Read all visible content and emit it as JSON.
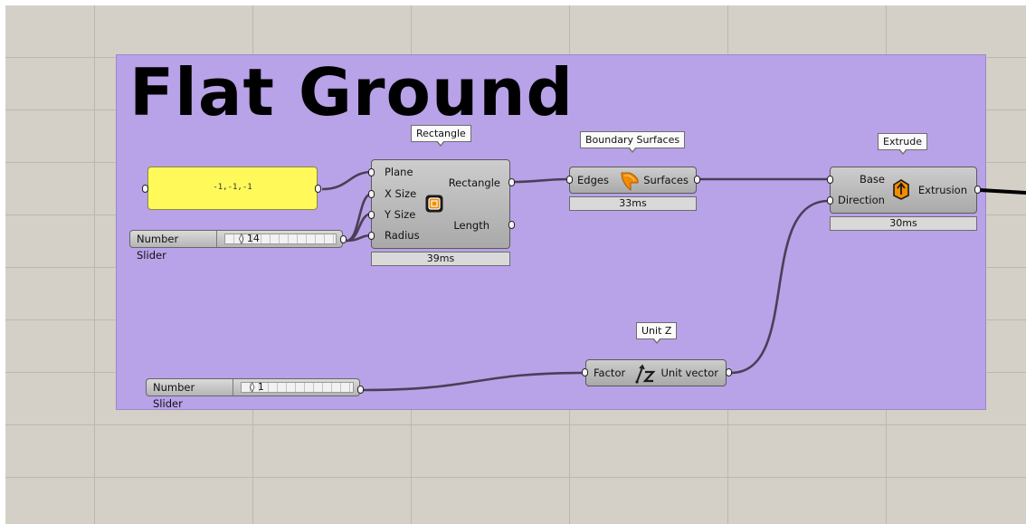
{
  "group": {
    "title": "Flat Ground",
    "color": "#b8a2e8"
  },
  "panel": {
    "text": "-1,-1,-1",
    "color": "#fff95a"
  },
  "sliders": [
    {
      "name": "Number Slider",
      "value": "◊ 14"
    },
    {
      "name": "Number Slider",
      "value": "◊ 1"
    }
  ],
  "rectangle": {
    "tag": "Rectangle",
    "inputs": [
      "Plane",
      "X Size",
      "Y Size",
      "Radius"
    ],
    "outputs": [
      "Rectangle",
      "Length"
    ],
    "icon": "rectangle-icon",
    "timing": "39ms"
  },
  "boundary": {
    "tag": "Boundary Surfaces",
    "input": "Edges",
    "output": "Surfaces",
    "icon": "boundary-surfaces-icon",
    "timing": "33ms"
  },
  "extrude": {
    "tag": "Extrude",
    "inputs": [
      "Base",
      "Direction"
    ],
    "output": "Extrusion",
    "icon": "extrude-icon",
    "timing": "30ms"
  },
  "unitz": {
    "tag": "Unit Z",
    "input": "Factor",
    "output": "Unit vector",
    "icon": "unit-z-icon"
  },
  "colors": {
    "accent": "#f28c00",
    "wire": "#4a3f56"
  }
}
